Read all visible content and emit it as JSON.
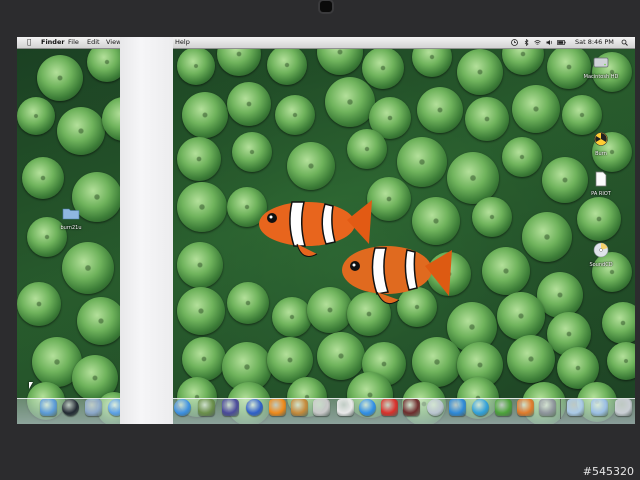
{
  "menubar": {
    "apple": "",
    "app_name": "Finder",
    "menus": [
      "File",
      "Edit",
      "View",
      "Help"
    ],
    "clock": "Sat 8:46 PM"
  },
  "desktop_icons": [
    {
      "label": "Macintosh HD",
      "icon": "hard-drive-icon"
    },
    {
      "label": "Burn",
      "icon": "burn-folder-icon"
    },
    {
      "label": "PA RIOT",
      "icon": "document-icon"
    },
    {
      "label": "SoundCD",
      "icon": "cd-icon"
    },
    {
      "label": "burn21u",
      "icon": "folder-icon"
    }
  ],
  "watermark": "#545320",
  "colors": {
    "menubar": "#e6e6e6",
    "anemone": "#6fb35c",
    "clownfish": "#e8651d"
  }
}
